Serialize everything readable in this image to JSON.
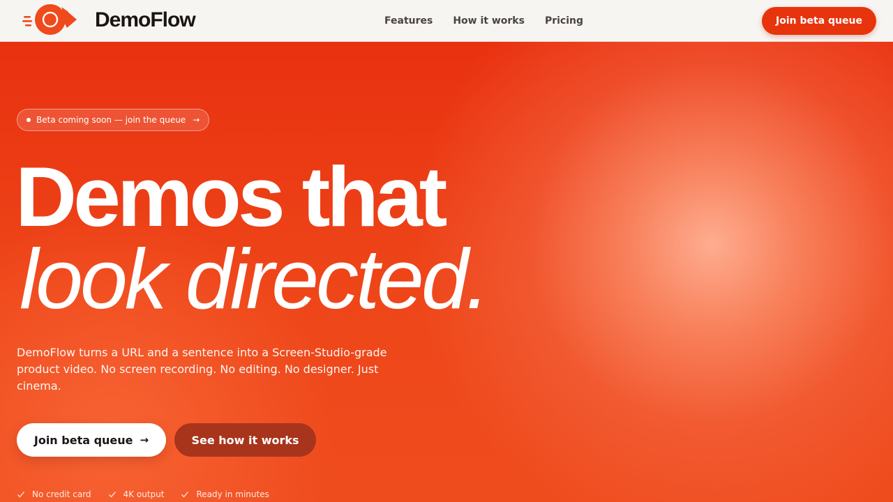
{
  "nav": {
    "brand": "DemoFlow",
    "links": [
      "Features",
      "How it works",
      "Pricing"
    ],
    "cta": "Join beta queue"
  },
  "hero": {
    "badge": "Beta coming soon — join the queue",
    "headline_line1": "Demos that",
    "headline_line2": "look directed.",
    "subtitle": "DemoFlow turns a URL and a sentence into a Screen-Studio-grade product video. No screen recording. No editing. No designer. Just cinema.",
    "primary_cta": "Join beta queue",
    "secondary_cta": "See how it works",
    "checks": [
      "No credit card",
      "4K output",
      "Ready in minutes"
    ]
  },
  "colors": {
    "accent": "#e8340d",
    "hero_start": "#e93110",
    "hero_glow": "#ffb296",
    "text_dark": "#1a1512",
    "secondary_button": "#a8341b"
  }
}
